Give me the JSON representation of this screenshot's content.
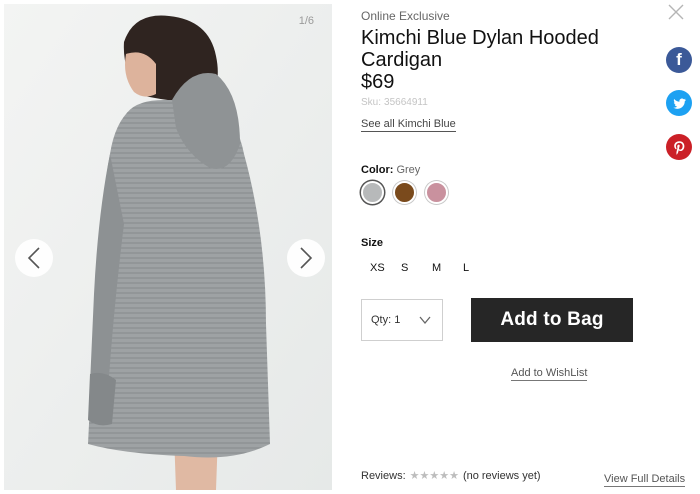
{
  "gallery": {
    "counter": "1/6"
  },
  "product": {
    "eyebrow": "Online Exclusive",
    "title": "Kimchi Blue Dylan Hooded Cardigan",
    "price": "$69",
    "sku_label": "Sku:",
    "sku_value": "35664911",
    "brand_link": "See all Kimchi Blue"
  },
  "color": {
    "label": "Color:",
    "selected": "Grey",
    "swatches": [
      {
        "name": "Grey",
        "hex": "#b7b9ba"
      },
      {
        "name": "Brown",
        "hex": "#7a4a1c"
      },
      {
        "name": "Pink",
        "hex": "#c9919e"
      }
    ]
  },
  "size": {
    "label": "Size",
    "options": [
      "XS",
      "S",
      "M",
      "L"
    ]
  },
  "purchase": {
    "qty_label": "Qty: 1",
    "add_button": "Add to Bag",
    "wishlist": "Add to WishList"
  },
  "reviews": {
    "label": "Reviews:",
    "stars": "★★★★★",
    "summary": "(no reviews yet)",
    "details_link": "View Full Details"
  },
  "social": {
    "facebook_glyph": "f"
  },
  "colors": {
    "button_bg": "#262626",
    "facebook": "#3b5998",
    "twitter": "#1da1f2",
    "pinterest": "#cb2027"
  }
}
